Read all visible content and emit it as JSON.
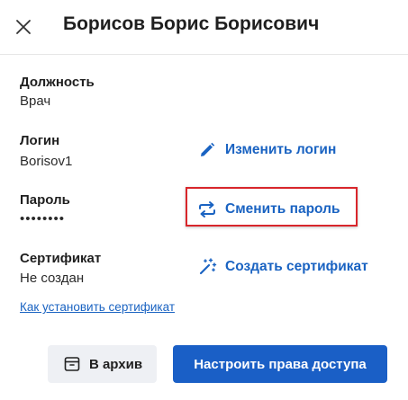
{
  "header": {
    "title": "Борисов Борис Борисович",
    "close_icon": "close-icon"
  },
  "fields": {
    "position": {
      "label": "Должность",
      "value": "Врач"
    },
    "login": {
      "label": "Логин",
      "value": "Borisov1"
    },
    "password": {
      "label": "Пароль",
      "value": "••••••••"
    },
    "certificate": {
      "label": "Сертификат",
      "value": "Не создан"
    }
  },
  "actions": {
    "change_login": {
      "label": "Изменить логин",
      "icon": "pencil-icon"
    },
    "change_password": {
      "label": "Сменить пароль",
      "icon": "swap-arrows-icon"
    },
    "create_certificate": {
      "label": "Создать сертификат",
      "icon": "magic-wand-icon"
    }
  },
  "help_link": "Как установить сертификат",
  "footer": {
    "archive_label": "В архив",
    "archive_icon": "archive-box-icon",
    "access_label": "Настроить права доступа"
  },
  "colors": {
    "accent": "#1a63c2",
    "primary_button": "#1a5fc6",
    "highlight": "#d8262b",
    "secondary_button_bg": "#eef0f4"
  }
}
